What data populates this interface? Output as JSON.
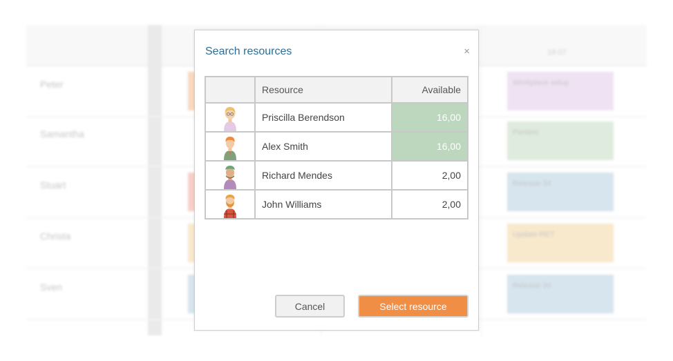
{
  "background": {
    "date_header": "18-07",
    "rows": [
      {
        "name": "Peter",
        "task": "Workplace setup",
        "task_color": "#e3cdea",
        "strip_color": "#f4b98a"
      },
      {
        "name": "Samantha",
        "task": "Pentest",
        "task_color": "#c6dcc4",
        "strip_color": ""
      },
      {
        "name": "Stuart",
        "task": "Release 34",
        "task_color": "#b7d0e2",
        "strip_color": "#f3a99a"
      },
      {
        "name": "Christa",
        "task": "Update RET",
        "task_color": "#f4d7a3",
        "strip_color": "#f6d6a6"
      },
      {
        "name": "Sven",
        "task": "Release 34",
        "task_color": "#b7d0e2",
        "strip_color": "#b7d0e2"
      }
    ]
  },
  "dialog": {
    "title": "Search resources",
    "close_icon": "×",
    "columns": {
      "resource": "Resource",
      "available": "Available"
    },
    "resources": [
      {
        "name": "Priscilla Berendson",
        "available": "16,00",
        "highlight": true,
        "avatar": "woman-glasses-avatar"
      },
      {
        "name": "Alex Smith",
        "available": "16,00",
        "highlight": true,
        "avatar": "man-orange-hair-avatar"
      },
      {
        "name": "Richard Mendes",
        "available": "2,00",
        "highlight": false,
        "avatar": "man-green-cap-avatar"
      },
      {
        "name": "John Williams",
        "available": "2,00",
        "highlight": false,
        "avatar": "man-beard-avatar"
      }
    ],
    "cancel_label": "Cancel",
    "select_label": "Select resource"
  },
  "colors": {
    "accent": "#f08e45",
    "title": "#2a6e9a",
    "available_highlight": "#bcd7bd"
  }
}
